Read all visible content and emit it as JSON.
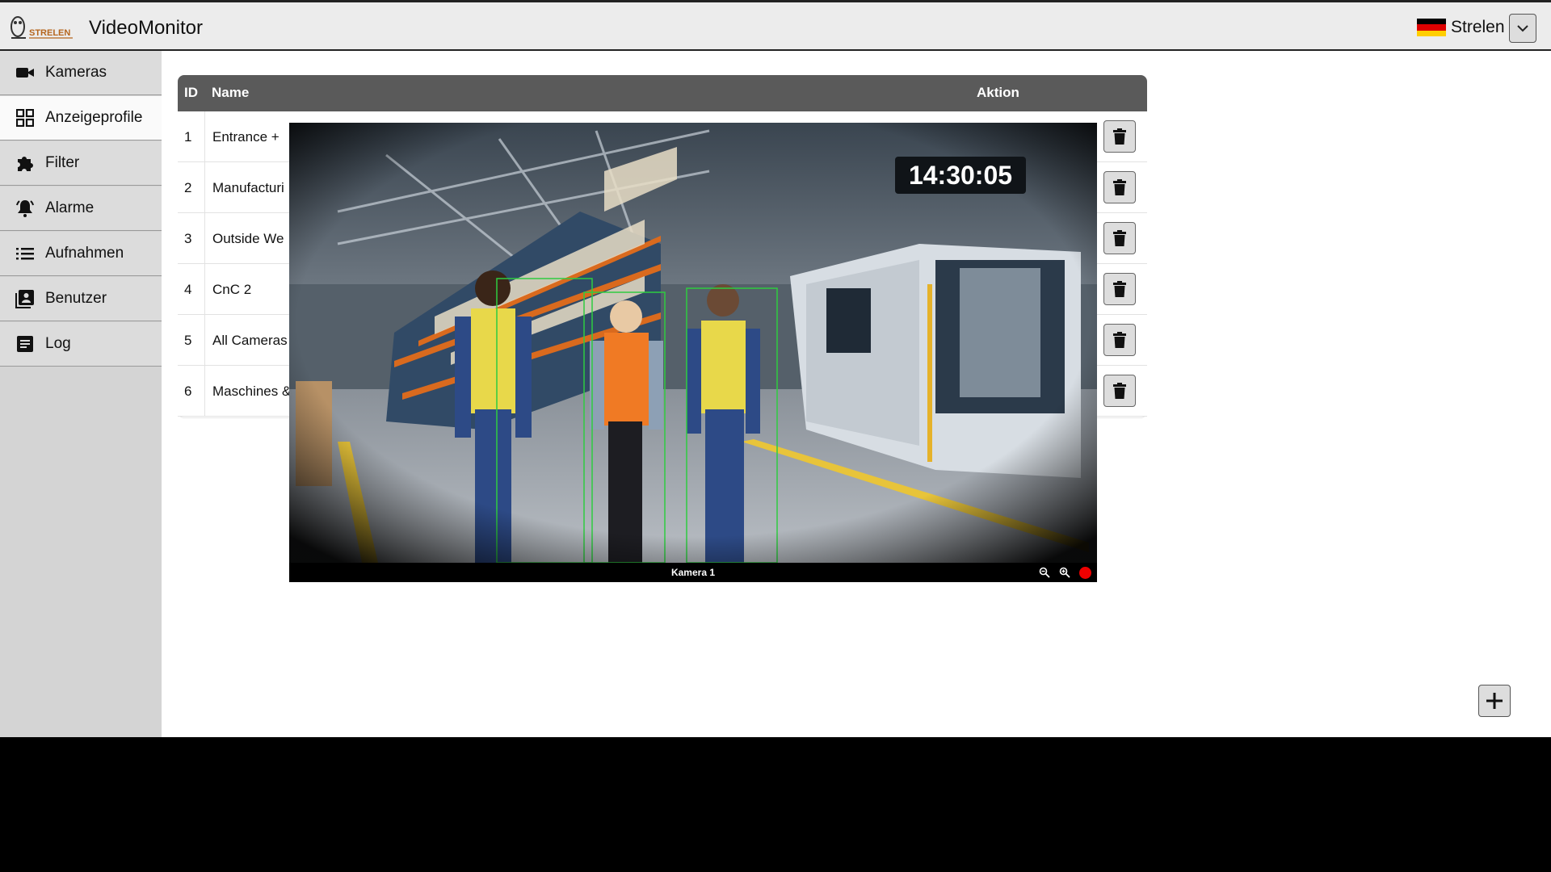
{
  "header": {
    "app_title": "VideoMonitor",
    "logo_text": "STRELEN",
    "user_name": "Strelen",
    "flag": "de-flag-icon"
  },
  "sidebar": {
    "items": [
      {
        "label": "Kameras",
        "icon": "video-camera-icon",
        "active": false
      },
      {
        "label": "Anzeigeprofile",
        "icon": "grid-icon",
        "active": true
      },
      {
        "label": "Filter",
        "icon": "puzzle-icon",
        "active": false
      },
      {
        "label": "Alarme",
        "icon": "bell-icon",
        "active": false
      },
      {
        "label": "Aufnahmen",
        "icon": "list-icon",
        "active": false
      },
      {
        "label": "Benutzer",
        "icon": "user-card-icon",
        "active": false
      },
      {
        "label": "Log",
        "icon": "document-icon",
        "active": false
      }
    ]
  },
  "table": {
    "headers": {
      "id": "ID",
      "name": "Name",
      "action": "Aktion"
    },
    "rows": [
      {
        "id": "1",
        "name": "Entrance + "
      },
      {
        "id": "2",
        "name": "Manufacturi"
      },
      {
        "id": "3",
        "name": "Outside We"
      },
      {
        "id": "4",
        "name": "CnC 2"
      },
      {
        "id": "5",
        "name": "All Cameras"
      },
      {
        "id": "6",
        "name": "Maschines &"
      }
    ]
  },
  "camera_popup": {
    "label": "Kamera 1",
    "timestamp": "14:30:05"
  },
  "colors": {
    "header_bg": "#ececec",
    "sidebar_bg": "#d4d4d4",
    "table_header_bg": "#5a5a5a",
    "record": "#ee0000",
    "detection_box": "#2ecc40"
  }
}
